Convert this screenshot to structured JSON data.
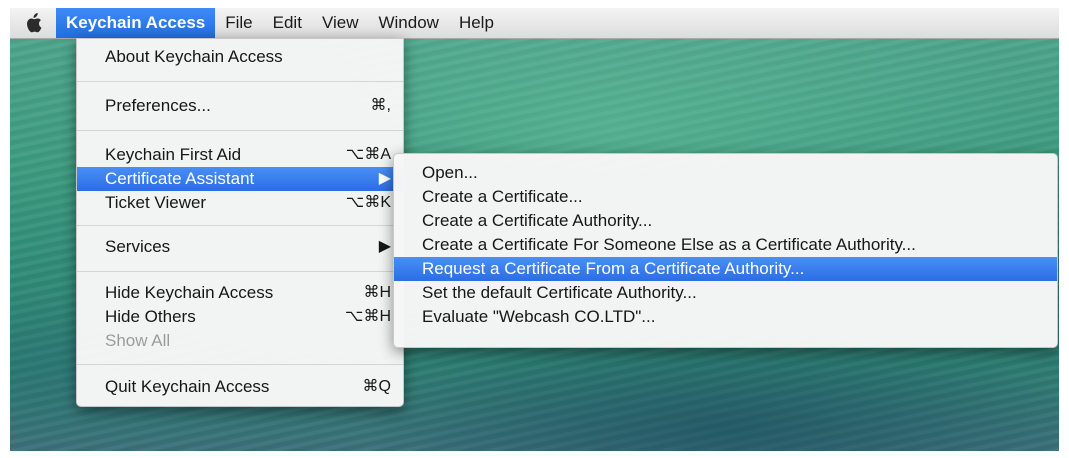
{
  "menubar": {
    "items": [
      "Keychain Access",
      "File",
      "Edit",
      "View",
      "Window",
      "Help"
    ]
  },
  "main_menu": {
    "items": [
      {
        "label": "About Keychain Access",
        "shortcut": ""
      },
      {
        "label": "Preferences...",
        "shortcut": "⌘,"
      },
      {
        "label": "Keychain First Aid",
        "shortcut": "⌥⌘A"
      },
      {
        "label": "Certificate Assistant",
        "shortcut": "▶"
      },
      {
        "label": "Ticket Viewer",
        "shortcut": "⌥⌘K"
      },
      {
        "label": "Services",
        "shortcut": "▶"
      },
      {
        "label": "Hide Keychain Access",
        "shortcut": "⌘H"
      },
      {
        "label": "Hide Others",
        "shortcut": "⌥⌘H"
      },
      {
        "label": "Show All",
        "shortcut": ""
      },
      {
        "label": "Quit Keychain Access",
        "shortcut": "⌘Q"
      }
    ]
  },
  "submenu": {
    "items": [
      "Open...",
      "Create a Certificate...",
      "Create a Certificate Authority...",
      "Create a Certificate For Someone Else as a Certificate Authority...",
      "Request a Certificate From a Certificate Authority...",
      "Set the default Certificate Authority...",
      "Evaluate \"Webcash CO.LTD\"..."
    ]
  },
  "colors": {
    "highlight": "#2a6ee4",
    "menubar": "#e6e6e6",
    "desktop": "#3d9a7f"
  },
  "icons": {
    "apple": "apple-logo-icon"
  }
}
